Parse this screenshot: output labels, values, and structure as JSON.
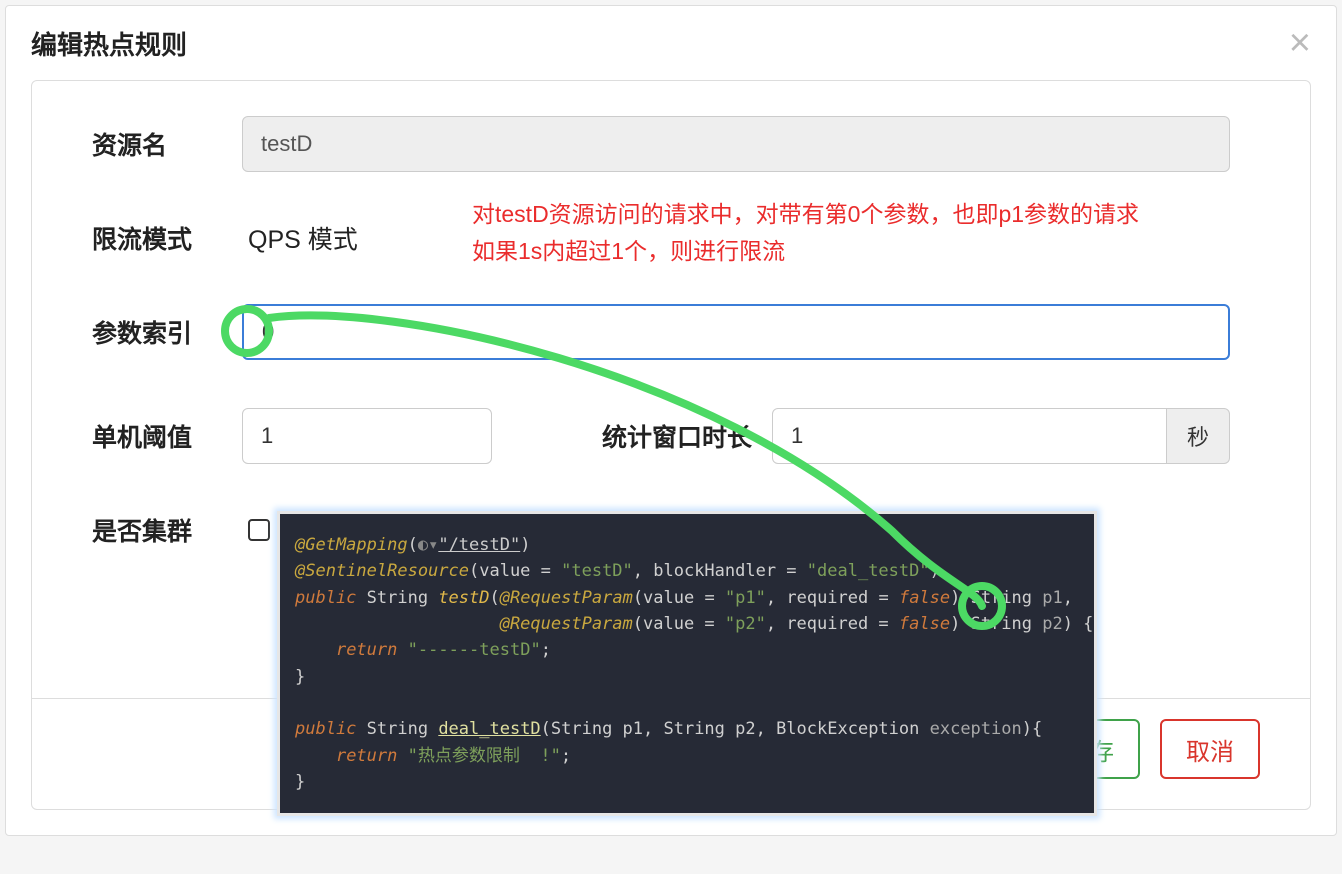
{
  "dialog": {
    "title": "编辑热点规则",
    "close": "×"
  },
  "form": {
    "resource": {
      "label": "资源名",
      "value": "testD"
    },
    "mode": {
      "label": "限流模式",
      "value": "QPS 模式"
    },
    "index": {
      "label": "参数索引",
      "value": "0"
    },
    "threshold": {
      "label": "单机阈值",
      "value": "1"
    },
    "window": {
      "label": "统计窗口时长",
      "value": "1",
      "unit": "秒"
    },
    "cluster": {
      "label": "是否集群"
    }
  },
  "note": {
    "line1": "对testD资源访问的请求中，对带有第0个参数，也即p1参数的请求",
    "line2": "如果1s内超过1个，则进行限流"
  },
  "code": {
    "l1a": "@GetMapping",
    "l1b": "(",
    "l1c": "\"/testD\"",
    "l1d": ")",
    "l2a": "@SentinelResource",
    "l2b": "(value = ",
    "l2c": "\"testD\"",
    "l2d": ", blockHandler = ",
    "l2e": "\"deal_testD\"",
    "l2f": ")",
    "l3a": "public",
    "l3b": " String ",
    "l3c": "testD",
    "l3d": "(",
    "l3e": "@RequestParam",
    "l3f": "(value = ",
    "l3g": "\"p1\"",
    "l3h": ", required = ",
    "l3i": "false",
    "l3j": ") String ",
    "l3k": "p1",
    "l3l": ",",
    "l4a": "                    ",
    "l4b": "@RequestParam",
    "l4c": "(value = ",
    "l4d": "\"p2\"",
    "l4e": ", required = ",
    "l4f": "false",
    "l4g": ") String ",
    "l4h": "p2",
    "l4i": ") {",
    "l5a": "    ",
    "l5b": "return",
    "l5c": " ",
    "l5d": "\"------testD\"",
    "l5e": ";",
    "l6": "}",
    "l7": "",
    "l8a": "public",
    "l8b": " String ",
    "l8c": "deal_testD",
    "l8d": "(String p1, String p2, BlockException ",
    "l8e": "exception",
    "l8f": "){",
    "l9a": "    ",
    "l9b": "return",
    "l9c": " ",
    "l9d": "\"热点参数限制  !\"",
    "l9e": ";",
    "l10": "}"
  },
  "footer": {
    "save": "保存",
    "cancel": "取消"
  }
}
